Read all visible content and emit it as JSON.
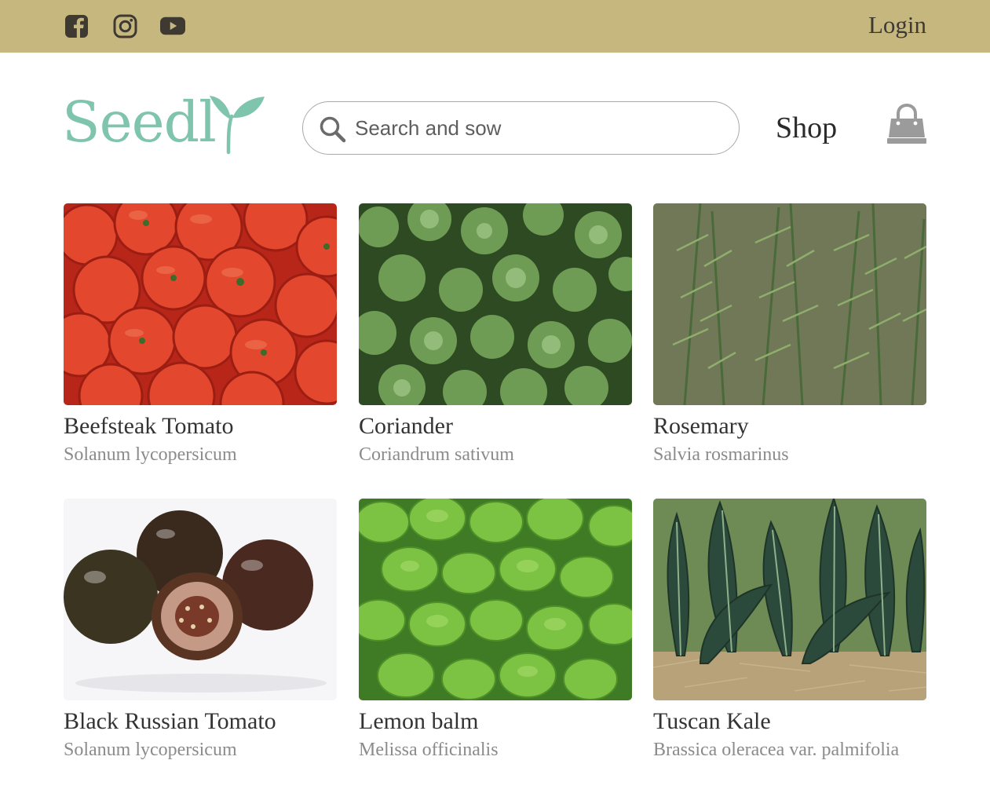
{
  "topbar": {
    "background": "#c6b77f",
    "social_icons": [
      "facebook-icon",
      "instagram-icon",
      "youtube-icon"
    ],
    "login_label": "Login"
  },
  "header": {
    "logo_text": "Seedl",
    "logo_color": "#7fc5ad",
    "search": {
      "placeholder": "Search and sow",
      "value": ""
    },
    "shop_label": "Shop",
    "bag_icon": "shopping-bag-icon"
  },
  "products": [
    {
      "name": "Beefsteak Tomato",
      "latin": "Solanum lycopersicum",
      "image": "red-tomatoes"
    },
    {
      "name": "Coriander",
      "latin": "Coriandrum sativum",
      "image": "coriander-leaves"
    },
    {
      "name": "Rosemary",
      "latin": "Salvia rosmarinus",
      "image": "rosemary-plant"
    },
    {
      "name": "Black Russian Tomato",
      "latin": "Solanum lycopersicum",
      "image": "dark-tomatoes"
    },
    {
      "name": "Lemon balm",
      "latin": "Melissa officinalis",
      "image": "lemon-balm-leaves"
    },
    {
      "name": "Tuscan Kale",
      "latin": "Brassica oleracea var. palmifolia",
      "image": "tuscan-kale"
    }
  ]
}
